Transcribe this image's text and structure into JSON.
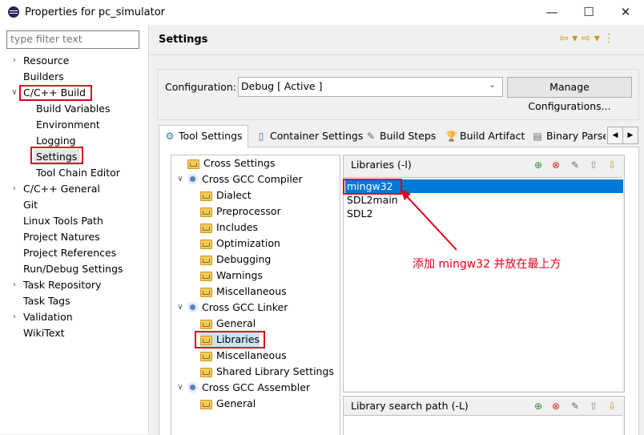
{
  "window": {
    "title": "Properties for pc_simulator",
    "minimize": "—",
    "maximize": "☐",
    "close": "✕"
  },
  "left": {
    "filter_placeholder": "type filter text",
    "items": [
      {
        "label": "Resource",
        "twisty": "›"
      },
      {
        "label": "Builders",
        "twisty": ""
      },
      {
        "label": "C/C++ Build",
        "twisty": "∨"
      },
      {
        "label": "Build Variables",
        "twisty": ""
      },
      {
        "label": "Environment",
        "twisty": ""
      },
      {
        "label": "Logging",
        "twisty": ""
      },
      {
        "label": "Settings",
        "twisty": ""
      },
      {
        "label": "Tool Chain Editor",
        "twisty": ""
      },
      {
        "label": "C/C++ General",
        "twisty": "›"
      },
      {
        "label": "Git",
        "twisty": ""
      },
      {
        "label": "Linux Tools Path",
        "twisty": ""
      },
      {
        "label": "Project Natures",
        "twisty": ""
      },
      {
        "label": "Project References",
        "twisty": ""
      },
      {
        "label": "Run/Debug Settings",
        "twisty": ""
      },
      {
        "label": "Task Repository",
        "twisty": "›"
      },
      {
        "label": "Task Tags",
        "twisty": ""
      },
      {
        "label": "Validation",
        "twisty": "›"
      },
      {
        "label": "WikiText",
        "twisty": ""
      }
    ]
  },
  "header": {
    "title": "Settings",
    "nav_icons": "⇦ ▾ ⇨ ▾ ⋮"
  },
  "config": {
    "label": "Configuration:",
    "value": "Debug  [ Active ]",
    "manage_button": "Manage Configurations..."
  },
  "tabs": [
    {
      "label": "Tool Settings",
      "icon": "⚙"
    },
    {
      "label": "Container Settings",
      "icon": "▯"
    },
    {
      "label": "Build Steps",
      "icon": "✎"
    },
    {
      "label": "Build Artifact",
      "icon": "🏆"
    },
    {
      "label": "Binary Parse",
      "icon": "▤"
    }
  ],
  "tab_scroll": {
    "left": "◀",
    "right": "▶"
  },
  "settings_tree": [
    {
      "label": "Cross Settings",
      "type": "folder",
      "level": 0,
      "twisty": ""
    },
    {
      "label": "Cross GCC Compiler",
      "type": "gear",
      "level": 0,
      "twisty": "∨"
    },
    {
      "label": "Dialect",
      "type": "folder",
      "level": 1,
      "twisty": ""
    },
    {
      "label": "Preprocessor",
      "type": "folder",
      "level": 1,
      "twisty": ""
    },
    {
      "label": "Includes",
      "type": "folder",
      "level": 1,
      "twisty": ""
    },
    {
      "label": "Optimization",
      "type": "folder",
      "level": 1,
      "twisty": ""
    },
    {
      "label": "Debugging",
      "type": "folder",
      "level": 1,
      "twisty": ""
    },
    {
      "label": "Warnings",
      "type": "folder",
      "level": 1,
      "twisty": ""
    },
    {
      "label": "Miscellaneous",
      "type": "folder",
      "level": 1,
      "twisty": ""
    },
    {
      "label": "Cross GCC Linker",
      "type": "gear",
      "level": 0,
      "twisty": "∨"
    },
    {
      "label": "General",
      "type": "folder",
      "level": 1,
      "twisty": ""
    },
    {
      "label": "Libraries",
      "type": "folder",
      "level": 1,
      "twisty": ""
    },
    {
      "label": "Miscellaneous",
      "type": "folder",
      "level": 1,
      "twisty": ""
    },
    {
      "label": "Shared Library Settings",
      "type": "folder",
      "level": 1,
      "twisty": ""
    },
    {
      "label": "Cross GCC Assembler",
      "type": "gear",
      "level": 0,
      "twisty": "∨"
    },
    {
      "label": "General",
      "type": "folder",
      "level": 1,
      "twisty": ""
    }
  ],
  "libraries": {
    "label": "Libraries (-l)",
    "items": [
      "mingw32",
      "SDL2main",
      "SDL2"
    ],
    "selected": "mingw32",
    "tool_icons": [
      "add-icon",
      "delete-icon",
      "edit-icon",
      "move-up-icon",
      "move-down-icon"
    ]
  },
  "search_path": {
    "label": "Library search path (-L)"
  },
  "annotation": "添加 mingw32 并放在最上方",
  "colors": {
    "highlight": "#e0001b",
    "selection": "#0078d7"
  }
}
